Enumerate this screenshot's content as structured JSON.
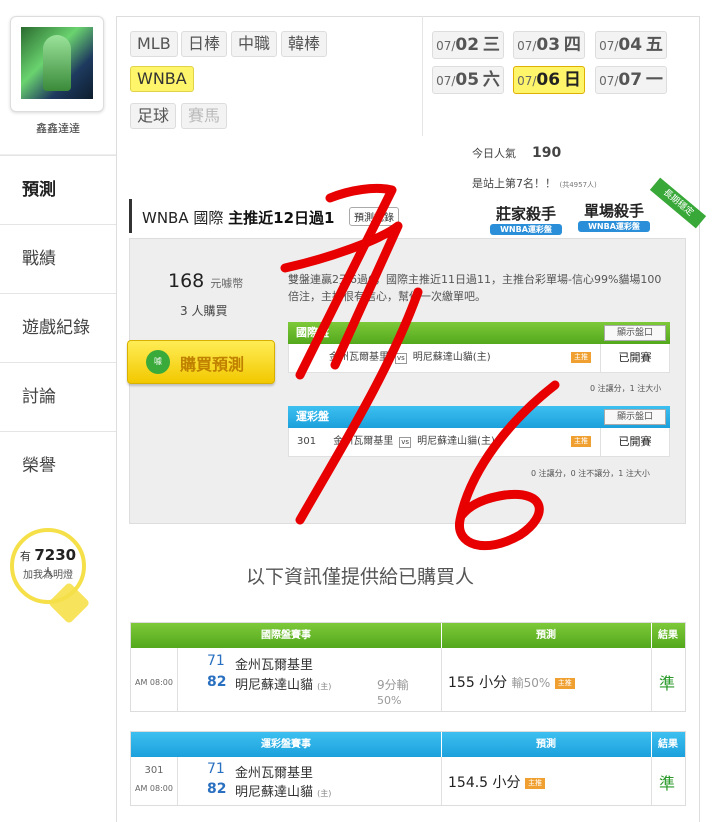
{
  "sidebar": {
    "username": "鑫鑫達達",
    "nav": [
      {
        "label": "預測",
        "active": true
      },
      {
        "label": "戰績",
        "active": false
      },
      {
        "label": "遊戲紀錄",
        "active": false
      },
      {
        "label": "討論",
        "active": false
      },
      {
        "label": "榮譽",
        "active": false
      }
    ],
    "fans": {
      "prefix": "有",
      "count": "7230",
      "suffix": "人",
      "sub": "加我為明燈"
    }
  },
  "leagues": [
    {
      "label": "MLB"
    },
    {
      "label": "日棒"
    },
    {
      "label": "中職"
    },
    {
      "label": "韓棒"
    },
    {
      "label": "WNBA",
      "active": true
    },
    {
      "label": "足球"
    },
    {
      "label": "賽馬",
      "disabled": true
    }
  ],
  "dates": [
    {
      "prefix": "07/",
      "day": "02",
      "wd": "三"
    },
    {
      "prefix": "07/",
      "day": "03",
      "wd": "四"
    },
    {
      "prefix": "07/",
      "day": "04",
      "wd": "五"
    },
    {
      "prefix": "07/",
      "day": "05",
      "wd": "六"
    },
    {
      "prefix": "07/",
      "day": "06",
      "wd": "日",
      "active": true
    },
    {
      "prefix": "07/",
      "day": "07",
      "wd": "一"
    }
  ],
  "stats": {
    "popularity_label": "今日人氣",
    "popularity_value": "190",
    "rank_text": "是站上第7名！！",
    "rank_total": "(共4957人)"
  },
  "title": {
    "prefix": "WNBA 國際",
    "bold": "主推近12日過1",
    "record_button": "預測記錄"
  },
  "badges": [
    {
      "title": "莊家殺手",
      "sub": "WNBA運彩盤"
    },
    {
      "title": "單場殺手",
      "sub": "WNBA運彩盤"
    }
  ],
  "ribbon": "長期穩定",
  "purchase": {
    "price": "168",
    "price_unit": "元噱幣",
    "buyers": "3 人購買",
    "buy_button": "購買預測",
    "buy_icon": "噱",
    "description": "雙盤連贏2天6過6，國際主推近11日過11，主推台彩單場-信心99%貓場100倍注，主推很有信心，幫你一次繳單吧。"
  },
  "intl_table": {
    "header": "國際盤",
    "show_button": "顯示盤口",
    "home": "金州瓦爾基里",
    "vs": "vs",
    "away": "明尼蘇達山貓(主)",
    "badge": "主推",
    "status": "已開賽",
    "note": "0 注讓分，1 注大小"
  },
  "lottery_table": {
    "header": "運彩盤",
    "show_button": "顯示盤口",
    "id": "301",
    "home": "金州瓦爾基里",
    "vs": "vs",
    "away": "明尼蘇達山貓(主)",
    "badge": "主推",
    "status": "已開賽",
    "note": "0 注讓分，0 注不讓分，1 注大小"
  },
  "info_heading": "以下資訊僅提供給已購買人",
  "result_intl": {
    "headers": [
      "國際盤賽事",
      "預測",
      "結果"
    ],
    "time": "AM 08:00",
    "score_away": "71",
    "team_away": "金州瓦爾基里",
    "score_home": "82",
    "team_home": "明尼蘇達山貓",
    "home_tag": "(主)",
    "spread_line1": "9分輸",
    "spread_line2": "50%",
    "pick": "155 小分",
    "pick_extra": "輸50%",
    "pick_badge": "主推",
    "result": "準"
  },
  "result_lottery": {
    "headers": [
      "運彩盤賽事",
      "預測",
      "結果"
    ],
    "id": "301",
    "time": "AM 08:00",
    "score_away": "71",
    "team_away": "金州瓦爾基里",
    "score_home": "82",
    "team_home": "明尼蘇達山貓",
    "home_tag": "(主)",
    "pick": "154.5 小分",
    "pick_badge": "主推",
    "result": "準"
  },
  "colors": {
    "accent_yellow": "#fff56a",
    "header_green": "#53a81c",
    "header_blue": "#1ba0dc",
    "ink_red": "#e80000",
    "result_green": "#2a9a2a"
  }
}
